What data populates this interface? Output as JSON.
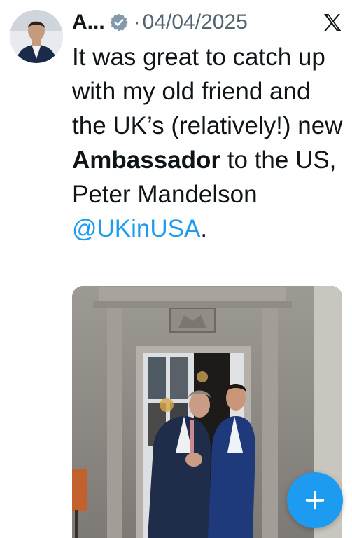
{
  "post": {
    "author_name": "A...",
    "separator": "·",
    "date": "04/04/2025",
    "text_before": "It was great to catch up with my old friend and the UK’s (relatively!) new ",
    "text_bold": "Ambassador",
    "text_after": " to the US, Peter Mandelson ",
    "mention": "@UKinUSA",
    "text_end": "."
  },
  "icons": {
    "verified": "verified-badge-icon",
    "platform": "x-logo-icon",
    "compose": "plus-icon"
  },
  "colors": {
    "accent": "#1d9bf0",
    "text": "#0f1419",
    "muted": "#536471"
  }
}
